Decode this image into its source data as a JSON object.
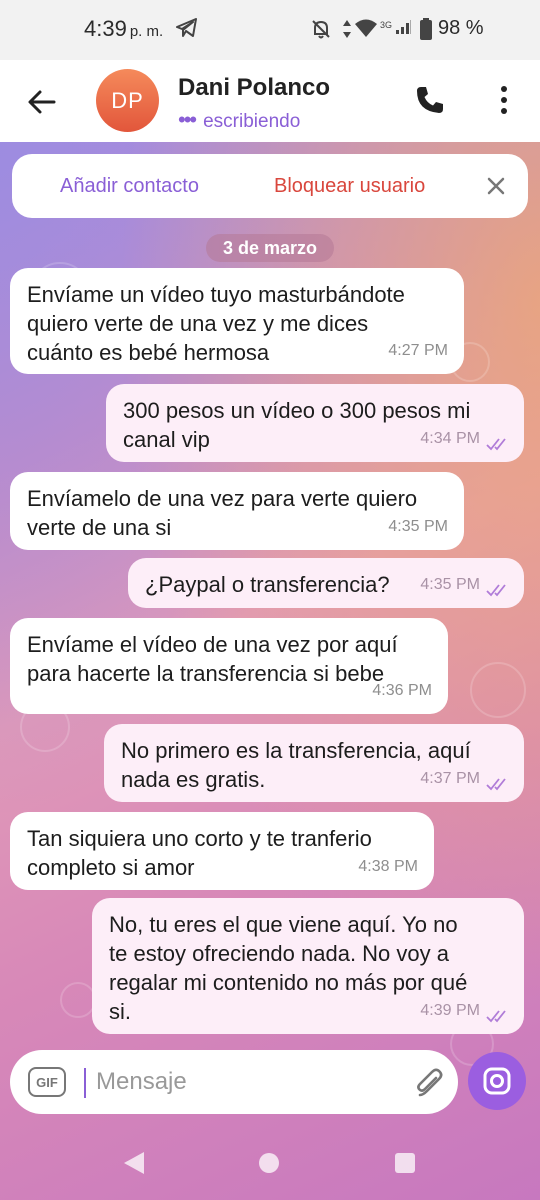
{
  "status_bar": {
    "time": "4:39",
    "time_suffix": "p. m.",
    "network": "3G",
    "battery": "98 %"
  },
  "header": {
    "avatar_initials": "DP",
    "avatar_color": "#e9683f",
    "contact_name": "Dani Polanco",
    "status": "escribiendo"
  },
  "action_bar": {
    "add_contact": "Añadir contacto",
    "block_user": "Bloquear usuario"
  },
  "date_chip": "3 de marzo",
  "messages": [
    {
      "direction": "in",
      "text": "Envíame un vídeo tuyo masturbándote\nquiero verte de una vez y me dices\ncuánto es bebé hermosa",
      "time": "4:27 PM"
    },
    {
      "direction": "out",
      "text": "300 pesos un vídeo o 300 pesos mi\ncanal vip",
      "time": "4:34 PM",
      "read": true
    },
    {
      "direction": "in",
      "text": "Envíamelo de una vez para verte quiero\nverte de una si",
      "time": "4:35 PM"
    },
    {
      "direction": "out",
      "text": "¿Paypal o transferencia?",
      "time": "4:35 PM",
      "read": true
    },
    {
      "direction": "in",
      "text": "Envíame el vídeo de una vez por aquí\npara hacerte la transferencia si bebe",
      "time": "4:36 PM"
    },
    {
      "direction": "out",
      "text": "No primero es la transferencia, aquí\nnada es gratis.",
      "time": "4:37 PM",
      "read": true
    },
    {
      "direction": "in",
      "text": "Tan siquiera uno corto y te tranferio\ncompleto si amor",
      "time": "4:38 PM"
    },
    {
      "direction": "out",
      "text": "No, tu eres el que viene aquí. Yo no\nte estoy ofreciendo nada. No voy a\nregalar mi contenido no más por qué\nsi.",
      "time": "4:39 PM",
      "read": true
    }
  ],
  "composer": {
    "gif_label": "GIF",
    "placeholder": "Mensaje"
  },
  "colors": {
    "accent": "#8a5fd6",
    "danger": "#d9473d",
    "outgoing_bubble": "#fdeef8",
    "camera_button": "#9b5ee0"
  },
  "icons": [
    "telegram-icon",
    "mute-icon",
    "wifi-icon",
    "signal-icon",
    "battery-icon",
    "back-arrow-icon",
    "phone-icon",
    "more-vertical-icon",
    "close-icon",
    "double-check-icon",
    "gif-icon",
    "paperclip-icon",
    "camera-icon",
    "nav-back-icon",
    "nav-home-icon",
    "nav-recents-icon"
  ]
}
